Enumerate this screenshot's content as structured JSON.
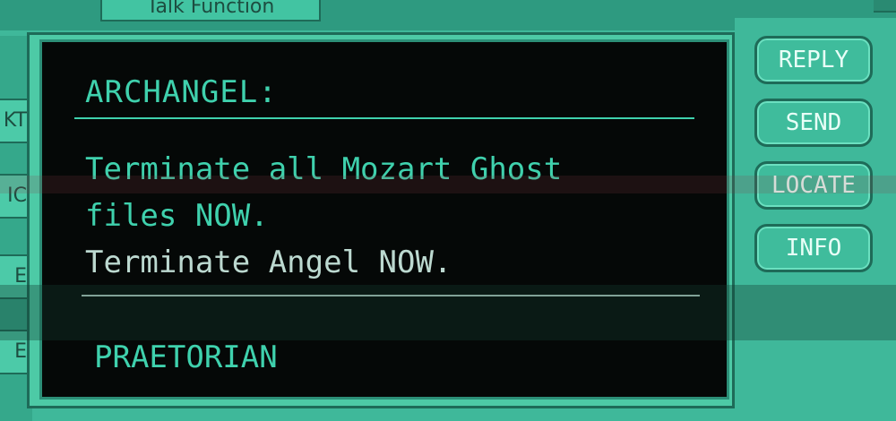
{
  "window": {
    "title_tab": "Talk Function",
    "left_tab_letters": [
      "KT",
      "IC",
      "E",
      "E"
    ]
  },
  "screen": {
    "heading": "ARCHANGEL:",
    "message_lines": [
      "Terminate all Mozart Ghost",
      "files NOW.",
      "Terminate Angel NOW."
    ],
    "signature": "PRAETORIAN"
  },
  "buttons": {
    "reply": "REPLY",
    "send": "SEND",
    "locate": "LOCATE",
    "info": "INFO"
  },
  "colors": {
    "frame": "#3fb89a",
    "screen_bg": "#050807",
    "text": "#3fd1ad",
    "text_light": "#bcd9d0"
  }
}
